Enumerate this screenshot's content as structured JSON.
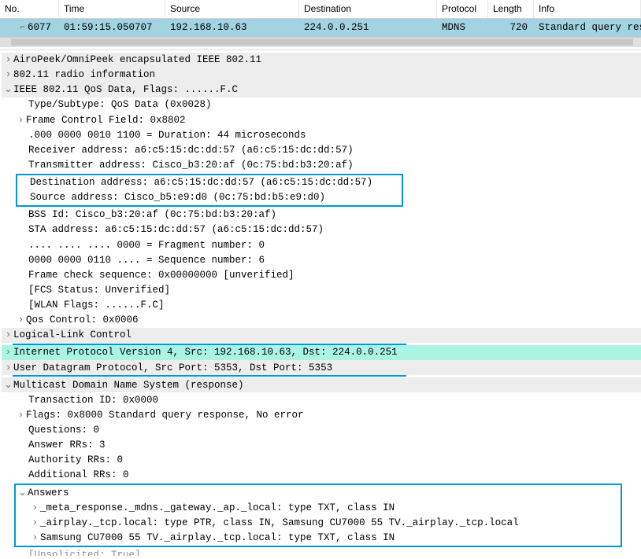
{
  "table": {
    "headers": {
      "no": "No.",
      "time": "Time",
      "source": "Source",
      "destination": "Destination",
      "protocol": "Protocol",
      "length": "Length",
      "info": "Info"
    },
    "row": {
      "no": "6077",
      "time": "01:59:15.050707",
      "source": "192.168.10.63",
      "destination": "224.0.0.251",
      "protocol": "MDNS",
      "length": "720",
      "info": "Standard query response"
    }
  },
  "tree": {
    "airopeek": "AiroPeek/OmniPeek encapsulated IEEE 802.11",
    "radio": "802.11 radio information",
    "ieee": "IEEE 802.11 QoS Data, Flags: ......F.C",
    "ieee_children": {
      "typesub": "Type/Subtype: QoS Data (0x0028)",
      "fcf": "Frame Control Field: 0x8802",
      "duration": ".000 0000 0010 1100 = Duration: 44 microseconds",
      "ra": "Receiver address: a6:c5:15:dc:dd:57 (a6:c5:15:dc:dd:57)",
      "ta": "Transmitter address: Cisco_b3:20:af (0c:75:bd:b3:20:af)",
      "da": "Destination address: a6:c5:15:dc:dd:57 (a6:c5:15:dc:dd:57)",
      "sa": "Source address: Cisco_b5:e9:d0 (0c:75:bd:b5:e9:d0)",
      "bss": "BSS Id: Cisco_b3:20:af (0c:75:bd:b3:20:af)",
      "sta": "STA address: a6:c5:15:dc:dd:57 (a6:c5:15:dc:dd:57)",
      "frag": ".... .... .... 0000 = Fragment number: 0",
      "seq": "0000 0000 0110 .... = Sequence number: 6",
      "fcs": "Frame check sequence: 0x00000000 [unverified]",
      "fcsstat": "[FCS Status: Unverified]",
      "wlan": "[WLAN Flags: ......F.C]",
      "qos": "Qos Control: 0x0006"
    },
    "llc": "Logical-Link Control",
    "ip": "Internet Protocol Version 4, Src: 192.168.10.63, Dst: 224.0.0.251",
    "udp": "User Datagram Protocol, Src Port: 5353, Dst Port: 5353",
    "mdns": "Multicast Domain Name System (response)",
    "mdns_children": {
      "txid": "Transaction ID: 0x0000",
      "flags": "Flags: 0x8000 Standard query response, No error",
      "questions": "Questions: 0",
      "answerrrs": "Answer RRs: 3",
      "authrrs": "Authority RRs: 0",
      "addrrs": "Additional RRs: 0",
      "answers": "Answers",
      "ans1": "_meta_response._mdns._gateway._ap._local: type TXT, class IN",
      "ans2": "_airplay._tcp.local: type PTR, class IN, Samsung CU7000 55 TV._airplay._tcp.local",
      "ans3": "Samsung CU7000 55 TV._airplay._tcp.local: type TXT, class IN",
      "unsolicited": "[Unsolicited: True]"
    }
  },
  "glyphs": {
    "closed": "›",
    "open": "⌄"
  }
}
